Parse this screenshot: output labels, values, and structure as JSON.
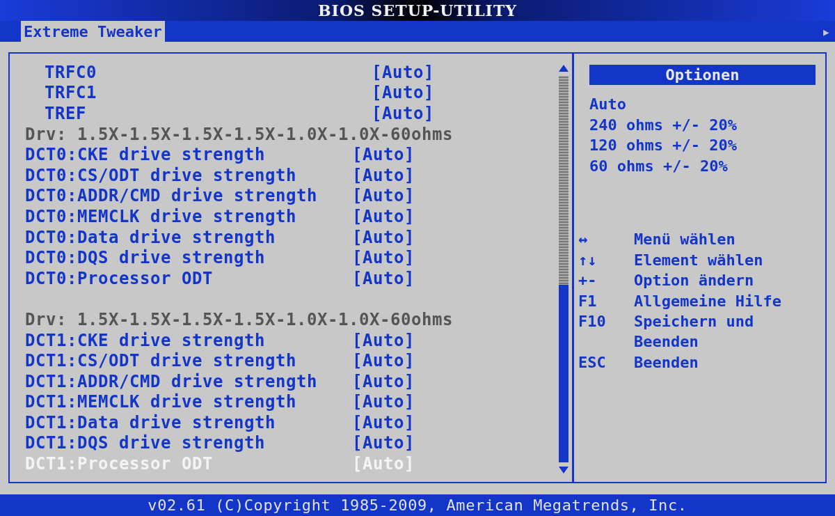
{
  "window": {
    "title": "BIOS SETUP-UTILITY"
  },
  "tabs": [
    {
      "label": "Extreme Tweaker",
      "selected": true
    }
  ],
  "tab_scroll": {
    "glyph": "▸"
  },
  "settings": [
    {
      "kind": "subsetting",
      "label": "TRFC0",
      "value": "[Auto]",
      "selected": false
    },
    {
      "kind": "subsetting",
      "label": "TRFC1",
      "value": "[Auto]",
      "selected": false
    },
    {
      "kind": "subsetting",
      "label": "TREF",
      "value": "[Auto]",
      "selected": false
    },
    {
      "kind": "info",
      "label": "Drv: 1.5X-1.5X-1.5X-1.5X-1.0X-1.0X-60ohms",
      "selected": false
    },
    {
      "kind": "setting",
      "label": "DCT0:CKE drive strength",
      "value": "[Auto]",
      "selected": false
    },
    {
      "kind": "setting",
      "label": "DCT0:CS/ODT drive strength",
      "value": "[Auto]",
      "selected": false
    },
    {
      "kind": "setting",
      "label": "DCT0:ADDR/CMD drive strength",
      "value": "[Auto]",
      "selected": false
    },
    {
      "kind": "setting",
      "label": "DCT0:MEMCLK drive strength",
      "value": "[Auto]",
      "selected": false
    },
    {
      "kind": "setting",
      "label": "DCT0:Data drive strength",
      "value": "[Auto]",
      "selected": false
    },
    {
      "kind": "setting",
      "label": "DCT0:DQS drive strength",
      "value": "[Auto]",
      "selected": false
    },
    {
      "kind": "setting",
      "label": "DCT0:Processor ODT",
      "value": "[Auto]",
      "selected": false
    },
    {
      "kind": "blank"
    },
    {
      "kind": "info",
      "label": "Drv: 1.5X-1.5X-1.5X-1.5X-1.0X-1.0X-60ohms",
      "selected": false
    },
    {
      "kind": "setting",
      "label": "DCT1:CKE drive strength",
      "value": "[Auto]",
      "selected": false
    },
    {
      "kind": "setting",
      "label": "DCT1:CS/ODT drive strength",
      "value": "[Auto]",
      "selected": false
    },
    {
      "kind": "setting",
      "label": "DCT1:ADDR/CMD drive strength",
      "value": "[Auto]",
      "selected": false
    },
    {
      "kind": "setting",
      "label": "DCT1:MEMCLK drive strength",
      "value": "[Auto]",
      "selected": false
    },
    {
      "kind": "setting",
      "label": "DCT1:Data drive strength",
      "value": "[Auto]",
      "selected": false
    },
    {
      "kind": "setting",
      "label": "DCT1:DQS drive strength",
      "value": "[Auto]",
      "selected": false
    },
    {
      "kind": "setting",
      "label": "DCT1:Processor ODT",
      "value": "[Auto]",
      "selected": true
    }
  ],
  "options_panel": {
    "title": "Optionen",
    "options": [
      "Auto",
      "240 ohms +/- 20%",
      "120 ohms +/- 20%",
      "60 ohms +/- 20%"
    ]
  },
  "help": [
    {
      "key": "↔",
      "action": "Menü wählen"
    },
    {
      "key": "↑↓",
      "action": "Element wählen"
    },
    {
      "key": "+-",
      "action": "Option ändern"
    },
    {
      "key": "F1",
      "action": "Allgemeine Hilfe"
    },
    {
      "key": "F10",
      "action": "Speichern und Beenden"
    },
    {
      "key": "ESC",
      "action": "Beenden"
    }
  ],
  "status_bar": "v02.61 (C)Copyright 1985-2009, American Megatrends, Inc."
}
